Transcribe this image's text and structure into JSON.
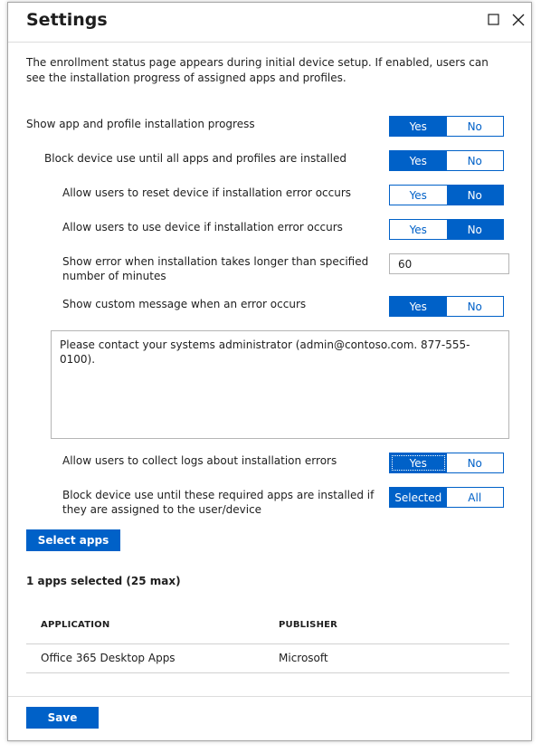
{
  "header": {
    "title": "Settings",
    "maximize_icon": "maximize-icon",
    "close_icon": "close-icon"
  },
  "description": "The enrollment status page appears during initial device setup. If enabled, users can see the installation progress of assigned apps and profiles.",
  "settings": {
    "show_progress": {
      "label": "Show app and profile installation progress",
      "yes": "Yes",
      "no": "No",
      "selected": "Yes"
    },
    "block_until_installed": {
      "label": "Block device use until all apps and profiles are installed",
      "yes": "Yes",
      "no": "No",
      "selected": "Yes"
    },
    "allow_reset": {
      "label": "Allow users to reset device if installation error occurs",
      "yes": "Yes",
      "no": "No",
      "selected": "No"
    },
    "allow_use": {
      "label": "Allow users to use device if installation error occurs",
      "yes": "Yes",
      "no": "No",
      "selected": "No"
    },
    "timeout": {
      "label": "Show error when installation takes longer than specified number of minutes",
      "value": "60"
    },
    "custom_message": {
      "label": "Show custom message when an error occurs",
      "yes": "Yes",
      "no": "No",
      "selected": "Yes"
    },
    "message_text": "Please contact your systems administrator (admin@contoso.com. 877-555-0100).",
    "collect_logs": {
      "label": "Allow users to collect logs about installation errors",
      "yes": "Yes",
      "no": "No",
      "selected": "Yes"
    },
    "required_apps": {
      "label": "Block device use until these required apps are installed if they are assigned to the user/device",
      "selected_label": "Selected",
      "all_label": "All",
      "selected": "Selected"
    }
  },
  "select_apps_button": "Select apps",
  "apps_count": "1 apps selected (25 max)",
  "table": {
    "columns": [
      "APPLICATION",
      "PUBLISHER"
    ],
    "rows": [
      {
        "application": "Office 365 Desktop Apps",
        "publisher": "Microsoft"
      }
    ]
  },
  "footer": {
    "save_label": "Save"
  },
  "colors": {
    "accent": "#0061c8",
    "border": "#a6a6a6",
    "text": "#1e1e1e"
  }
}
